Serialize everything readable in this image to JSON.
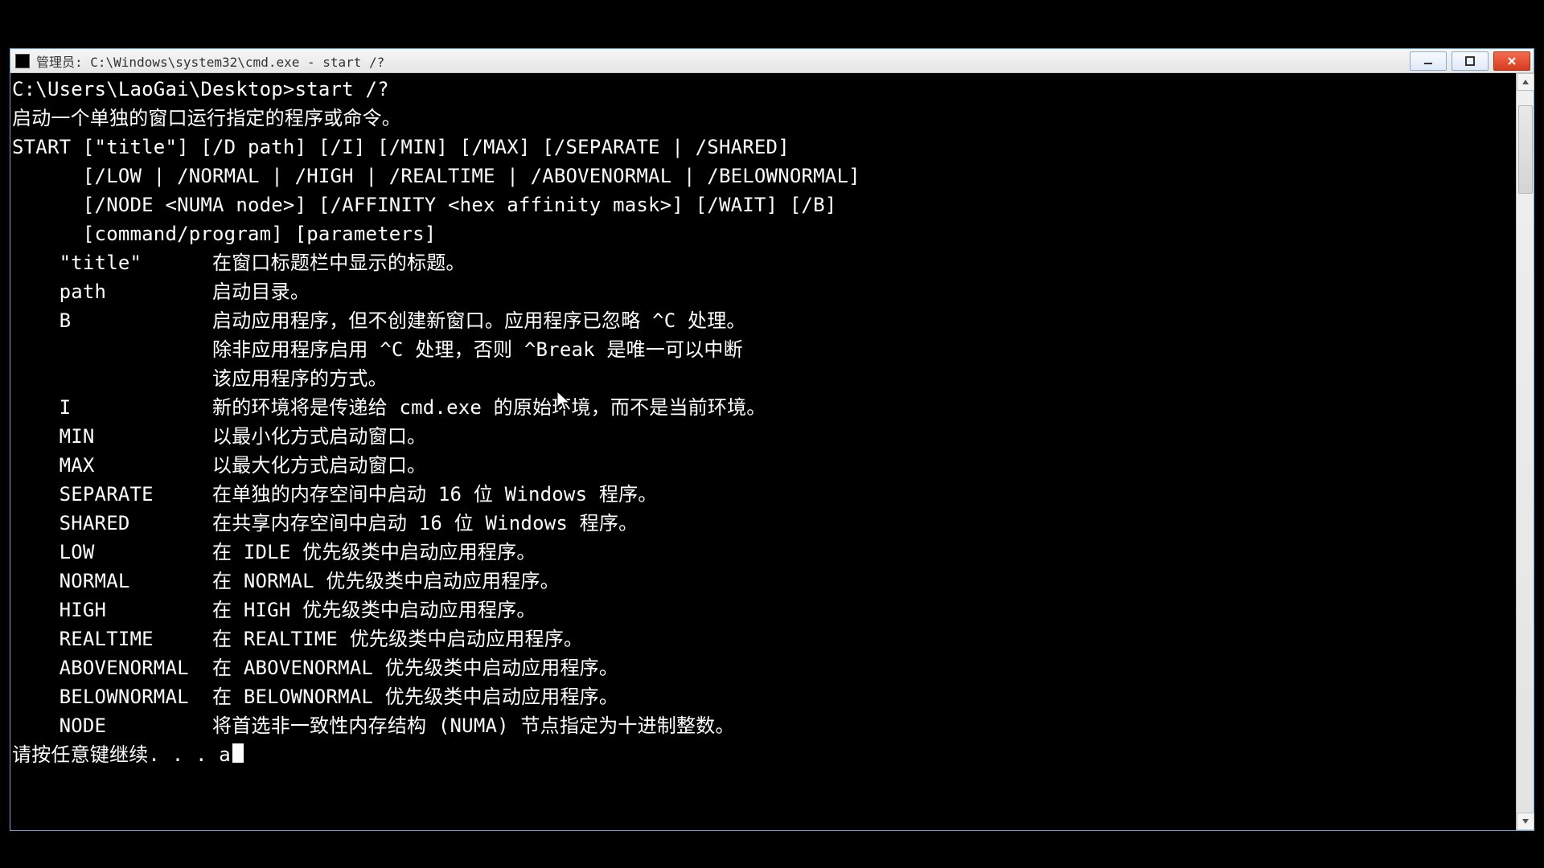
{
  "window": {
    "title": "管理员: C:\\Windows\\system32\\cmd.exe - start  /?"
  },
  "terminal": {
    "prompt_line": "C:\\Users\\LaoGai\\Desktop>start /?",
    "intro": "启动一个单独的窗口运行指定的程序或命令。",
    "syntax": [
      "START [\"title\"] [/D path] [/I] [/MIN] [/MAX] [/SEPARATE | /SHARED]",
      "      [/LOW | /NORMAL | /HIGH | /REALTIME | /ABOVENORMAL | /BELOWNORMAL]",
      "      [/NODE <NUMA node>] [/AFFINITY <hex affinity mask>] [/WAIT] [/B]",
      "      [command/program] [parameters]"
    ],
    "params": [
      {
        "key": "\"title\"",
        "desc": "在窗口标题栏中显示的标题。"
      },
      {
        "key": "path",
        "desc": "启动目录。"
      },
      {
        "key": "B",
        "desc": "启动应用程序，但不创建新窗口。应用程序已忽略 ^C 处理。"
      },
      {
        "key": "",
        "desc": "除非应用程序启用 ^C 处理，否则 ^Break 是唯一可以中断"
      },
      {
        "key": "",
        "desc": "该应用程序的方式。"
      },
      {
        "key": "I",
        "desc": "新的环境将是传递给 cmd.exe 的原始环境，而不是当前环境。"
      },
      {
        "key": "MIN",
        "desc": "以最小化方式启动窗口。"
      },
      {
        "key": "MAX",
        "desc": "以最大化方式启动窗口。"
      },
      {
        "key": "SEPARATE",
        "desc": "在单独的内存空间中启动 16 位 Windows 程序。"
      },
      {
        "key": "SHARED",
        "desc": "在共享内存空间中启动 16 位 Windows 程序。"
      },
      {
        "key": "LOW",
        "desc": "在 IDLE 优先级类中启动应用程序。"
      },
      {
        "key": "NORMAL",
        "desc": "在 NORMAL 优先级类中启动应用程序。"
      },
      {
        "key": "HIGH",
        "desc": "在 HIGH 优先级类中启动应用程序。"
      },
      {
        "key": "REALTIME",
        "desc": "在 REALTIME 优先级类中启动应用程序。"
      },
      {
        "key": "ABOVENORMAL",
        "desc": "在 ABOVENORMAL 优先级类中启动应用程序。"
      },
      {
        "key": "BELOWNORMAL",
        "desc": "在 BELOWNORMAL 优先级类中启动应用程序。"
      },
      {
        "key": "NODE",
        "desc": "将首选非一致性内存结构 (NUMA) 节点指定为十进制整数。"
      }
    ],
    "pause_prefix": "请按任意键继续. . . ",
    "pause_typed": "a"
  }
}
